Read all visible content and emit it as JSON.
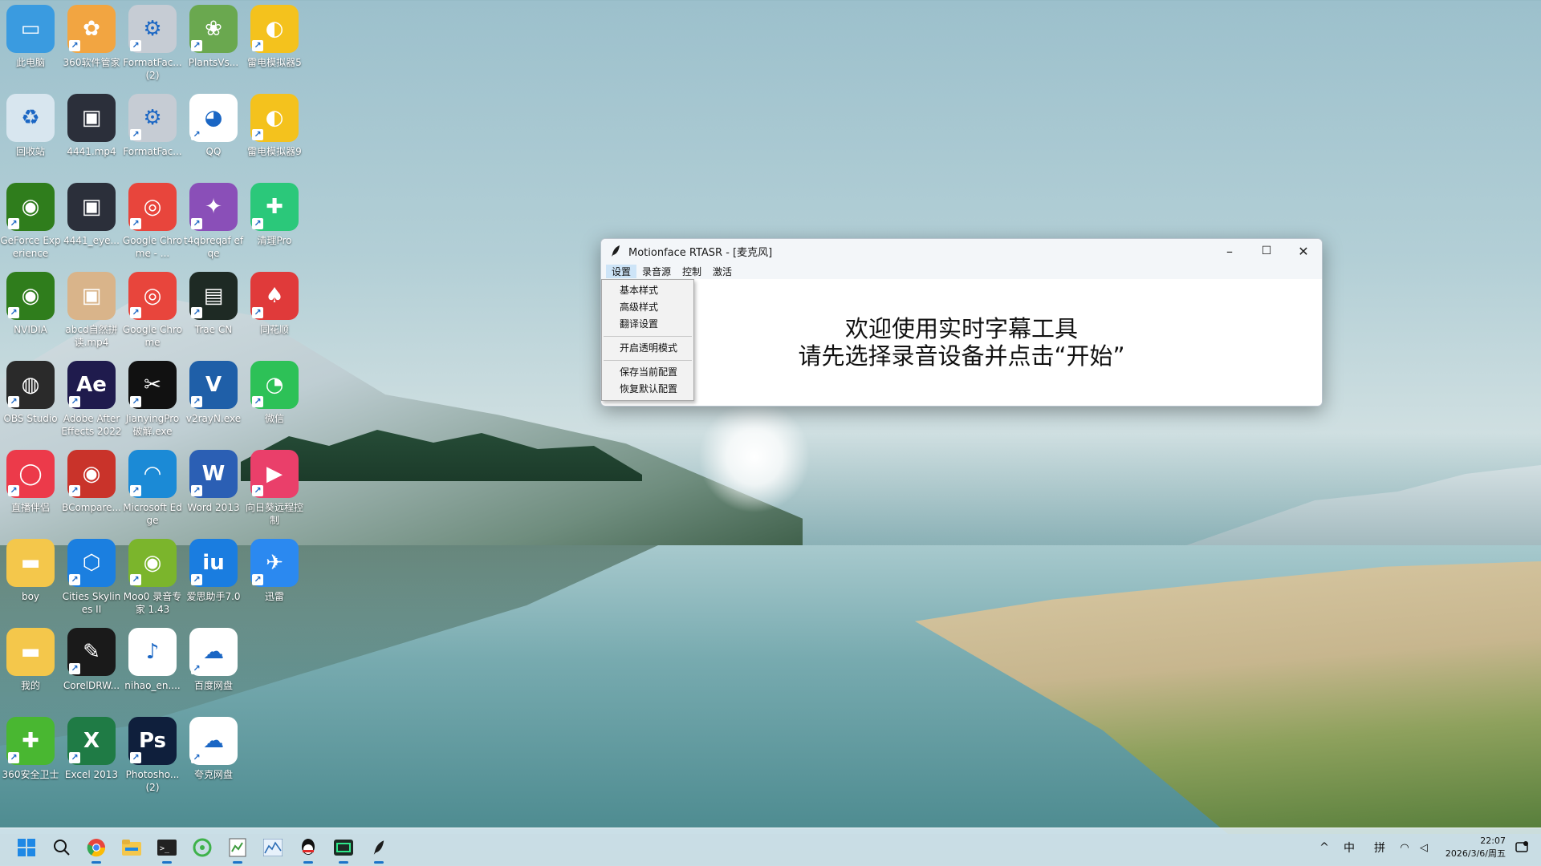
{
  "desktop": {
    "icons": [
      {
        "label": "此电脑",
        "glyph": "▭",
        "color": "#3a9be0",
        "shortcut": false
      },
      {
        "label": "360软件管家",
        "glyph": "✿",
        "color": "#f2a541",
        "shortcut": true
      },
      {
        "label": "FormatFac... (2)",
        "glyph": "⚙",
        "color": "#c6ccd4",
        "shortcut": true
      },
      {
        "label": "PlantsVs...",
        "glyph": "❀",
        "color": "#6aa84f",
        "shortcut": true
      },
      {
        "label": "雷电模拟器5",
        "glyph": "◐",
        "color": "#f4c21d",
        "shortcut": true
      },
      {
        "label": "回收站",
        "glyph": "♻",
        "color": "#d8e6ef",
        "shortcut": false
      },
      {
        "label": "4441.mp4",
        "glyph": "▣",
        "color": "#2b2f3a",
        "shortcut": false
      },
      {
        "label": "FormatFac...",
        "glyph": "⚙",
        "color": "#c6ccd4",
        "shortcut": true
      },
      {
        "label": "QQ",
        "glyph": "◕",
        "color": "#ffffff",
        "shortcut": true
      },
      {
        "label": "雷电模拟器9",
        "glyph": "◐",
        "color": "#f4c21d",
        "shortcut": true
      },
      {
        "label": "GeForce Experience",
        "glyph": "◉",
        "color": "#2f7d1c",
        "shortcut": true
      },
      {
        "label": "4441_eye...",
        "glyph": "▣",
        "color": "#2b2f3a",
        "shortcut": false
      },
      {
        "label": "Google Chrome - ...",
        "glyph": "◎",
        "color": "#e8453c",
        "shortcut": true
      },
      {
        "label": "t4qbreqaf efqe",
        "glyph": "✦",
        "color": "#8a4fb8",
        "shortcut": true
      },
      {
        "label": "清理Pro",
        "glyph": "✚",
        "color": "#2bc87a",
        "shortcut": true
      },
      {
        "label": "NVIDIA",
        "glyph": "◉",
        "color": "#2f7d1c",
        "shortcut": true
      },
      {
        "label": "abcd自然拼读.mp4",
        "glyph": "▣",
        "color": "#d9b48a",
        "shortcut": false
      },
      {
        "label": "Google Chrome",
        "glyph": "◎",
        "color": "#e8453c",
        "shortcut": true
      },
      {
        "label": "Trae CN",
        "glyph": "▤",
        "color": "#1e2a24",
        "shortcut": true
      },
      {
        "label": "同花顺",
        "glyph": "♠",
        "color": "#e03a3a",
        "shortcut": true
      },
      {
        "label": "OBS Studio",
        "glyph": "◍",
        "color": "#2a2a2a",
        "shortcut": true
      },
      {
        "label": "Adobe After Effects 2022",
        "glyph": "Ae",
        "color": "#1f1b4d",
        "shortcut": true
      },
      {
        "label": "JianyingPro 破解.exe",
        "glyph": "✂",
        "color": "#111111",
        "shortcut": true
      },
      {
        "label": "v2rayN.exe",
        "glyph": "V",
        "color": "#1f5fa8",
        "shortcut": true
      },
      {
        "label": "微信",
        "glyph": "◔",
        "color": "#2dc157",
        "shortcut": true
      },
      {
        "label": "直播伴侣",
        "glyph": "◯",
        "color": "#ec3a4a",
        "shortcut": true
      },
      {
        "label": "BCompare...",
        "glyph": "◉",
        "color": "#c9332a",
        "shortcut": true
      },
      {
        "label": "Microsoft Edge",
        "glyph": "◠",
        "color": "#1b8ad6",
        "shortcut": true
      },
      {
        "label": "Word 2013",
        "glyph": "W",
        "color": "#2b5fb4",
        "shortcut": true
      },
      {
        "label": "向日葵远程控制",
        "glyph": "▶",
        "color": "#ea3f6a",
        "shortcut": true
      },
      {
        "label": "boy",
        "glyph": "▬",
        "color": "#f4c74b",
        "shortcut": false
      },
      {
        "label": "Cities Skylines II",
        "glyph": "⬡",
        "color": "#1b7fe0",
        "shortcut": true
      },
      {
        "label": "Moo0 录音专家 1.43",
        "glyph": "◉",
        "color": "#7bb52c",
        "shortcut": true
      },
      {
        "label": "爱思助手7.0",
        "glyph": "iu",
        "color": "#1a7de0",
        "shortcut": true
      },
      {
        "label": "迅雷",
        "glyph": "✈",
        "color": "#2b89f0",
        "shortcut": true
      },
      {
        "label": "我的",
        "glyph": "▬",
        "color": "#f4c74b",
        "shortcut": false
      },
      {
        "label": "CorelDRW...",
        "glyph": "✎",
        "color": "#1a1a1a",
        "shortcut": true
      },
      {
        "label": "nihao_en....",
        "glyph": "♪",
        "color": "#ffffff",
        "shortcut": false
      },
      {
        "label": "百度网盘",
        "glyph": "☁",
        "color": "#ffffff",
        "shortcut": true
      },
      {
        "label": "360安全卫士",
        "glyph": "✚",
        "color": "#49b731",
        "shortcut": true
      },
      {
        "label": "Excel 2013",
        "glyph": "X",
        "color": "#1f7b45",
        "shortcut": true
      },
      {
        "label": "Photosho... (2)",
        "glyph": "Ps",
        "color": "#0f1f3c",
        "shortcut": true
      },
      {
        "label": "夸克网盘",
        "glyph": "☁",
        "color": "#ffffff",
        "shortcut": true
      }
    ]
  },
  "window": {
    "title": "Motionface RTASR - [麦克风]",
    "menu": [
      "设置",
      "录音源",
      "控制",
      "激活"
    ],
    "dropdown": [
      "基本样式",
      "高级样式",
      "翻译设置",
      "开启透明模式",
      "保存当前配置",
      "恢复默认配置"
    ],
    "line1": "欢迎使用实时字幕工具",
    "line2": "请先选择录音设备并点击“开始”",
    "minimize": "–",
    "maximize": "☐",
    "close": "✕"
  },
  "taskbar": {
    "items": [
      "start",
      "search",
      "chrome",
      "explorer",
      "terminal",
      "moo0",
      "editor",
      "chart",
      "qq",
      "trae",
      "rtasr"
    ],
    "tray": {
      "chevron": "^",
      "ime1": "中",
      "ime2": "拼",
      "wifi": "wifi-icon",
      "volume": "volume-icon"
    },
    "time": "22:07",
    "date": "2026/3/6/周五"
  }
}
